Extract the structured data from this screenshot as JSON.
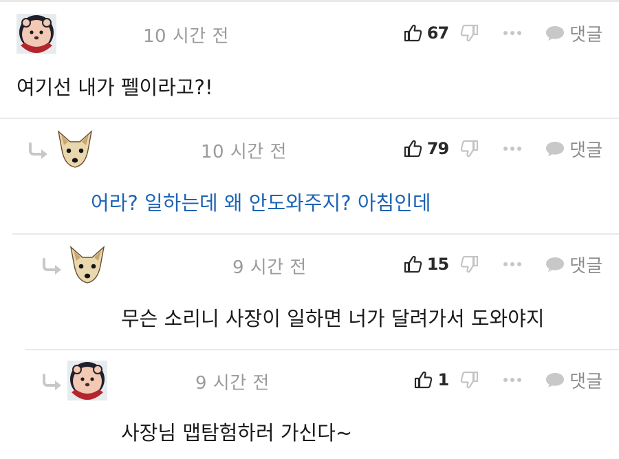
{
  "comments": [
    {
      "time": "10 시간 전",
      "likes": "67",
      "text": "여기선 내가 펠이라고?!",
      "avatar": "pink-bear-avatar",
      "is_reply": false,
      "reply_label": "댓글"
    },
    {
      "time": "10 시간 전",
      "likes": "79",
      "text": "어라? 일하는데 왜 안도와주지? 아침인데",
      "avatar": "fox-avatar",
      "is_reply": true,
      "text_color": "#1d64b4",
      "reply_label": "댓글"
    },
    {
      "time": "9 시간 전",
      "likes": "15",
      "text": "무슨 소리니 사장이 일하면 너가 달려가서 도와야지",
      "avatar": "fox-avatar",
      "is_reply": true,
      "reply_label": "댓글"
    },
    {
      "time": "9 시간 전",
      "likes": "1",
      "text": "사장님 맵탐험하러 가신다~",
      "avatar": "pink-bear-avatar",
      "is_reply": true,
      "reply_label": "댓글"
    }
  ],
  "icons": {
    "like": "thumbs-up-icon",
    "dislike": "thumbs-down-icon",
    "more": "more-dots-icon",
    "reply": "speech-bubble-icon",
    "reply_indicator": "reply-arrow-icon"
  },
  "colors": {
    "reply_text_highlight": "#1d64b4",
    "muted": "#9b9b9b",
    "divider": "#e9e9e9"
  }
}
